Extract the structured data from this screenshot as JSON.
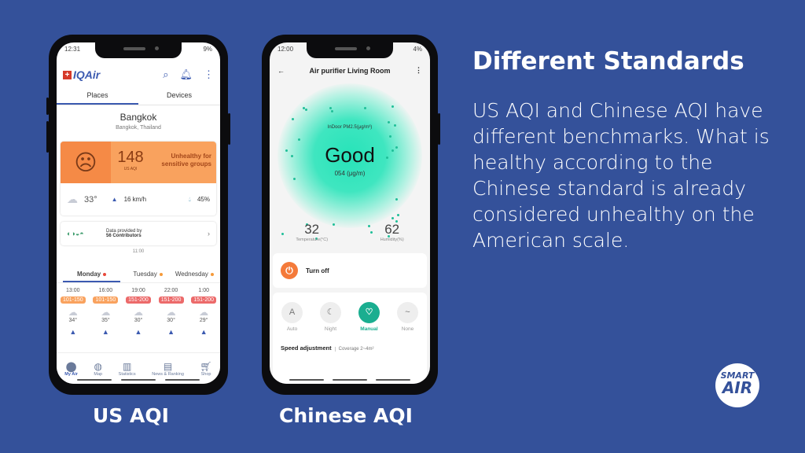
{
  "slide": {
    "title": "Different Standards",
    "body": "US AQI and Chinese AQI have different benchmarks. What is healthy according to the Chinese standard is already considered unhealthy on the American scale.",
    "caption_left": "US AQI",
    "caption_right": "Chinese AQI",
    "logo_top": "SMART",
    "logo_bottom": "AIR",
    "bg": "#34519a"
  },
  "iqair": {
    "time": "12:31",
    "battery": "9%",
    "logo": "IQAir",
    "tabs": [
      "Places",
      "Devices"
    ],
    "city": "Bangkok",
    "region": "Bangkok, Thailand",
    "aqi": "148",
    "aqi_label": "US AQI",
    "aqi_status": "Unhealthy for sensitive groups",
    "temp": "33°",
    "wind": "16 km/h",
    "humidity": "45%",
    "contrib_line1": "Data provided by",
    "contrib_line2": "56 Contributors",
    "updated": "11:00",
    "days": [
      {
        "name": "Monday",
        "dot": "#e8483a"
      },
      {
        "name": "Tuesday",
        "dot": "#f59a3a"
      },
      {
        "name": "Wednesday",
        "dot": "#f59a3a"
      }
    ],
    "forecast": [
      {
        "time": "13:00",
        "range": "101-150",
        "color": "#f9a25e",
        "temp": "34°"
      },
      {
        "time": "16:00",
        "range": "101-150",
        "color": "#f9a25e",
        "temp": "35°"
      },
      {
        "time": "19:00",
        "range": "151-200",
        "color": "#ec6a6a",
        "temp": "30°"
      },
      {
        "time": "22:00",
        "range": "151-200",
        "color": "#ec6a6a",
        "temp": "30°"
      },
      {
        "time": "1:00",
        "range": "151-200",
        "color": "#ec6a6a",
        "temp": "29°"
      }
    ],
    "nav": [
      "My Air",
      "Map",
      "Statistics",
      "News & Ranking",
      "Shop"
    ]
  },
  "purifier": {
    "time": "12:00",
    "title": "Air purifier Living Room",
    "pm_label": "InDoor PM2.5(μg/m³)",
    "status": "Good",
    "pm_value": "054 (μg/m)",
    "temp": "32",
    "temp_label": "Temperature(°C)",
    "humidity": "62",
    "humidity_label": "Humidity(%)",
    "power_label": "Turn off",
    "modes": [
      {
        "label": "Auto",
        "icon": "A"
      },
      {
        "label": "Night",
        "icon": "☾"
      },
      {
        "label": "Manual",
        "icon": "♡"
      },
      {
        "label": "None",
        "icon": "~"
      }
    ],
    "selected_mode": "Manual",
    "speed_label": "Speed adjustment",
    "coverage": "Coverage 2~4m²",
    "accent": "#1aae90"
  }
}
